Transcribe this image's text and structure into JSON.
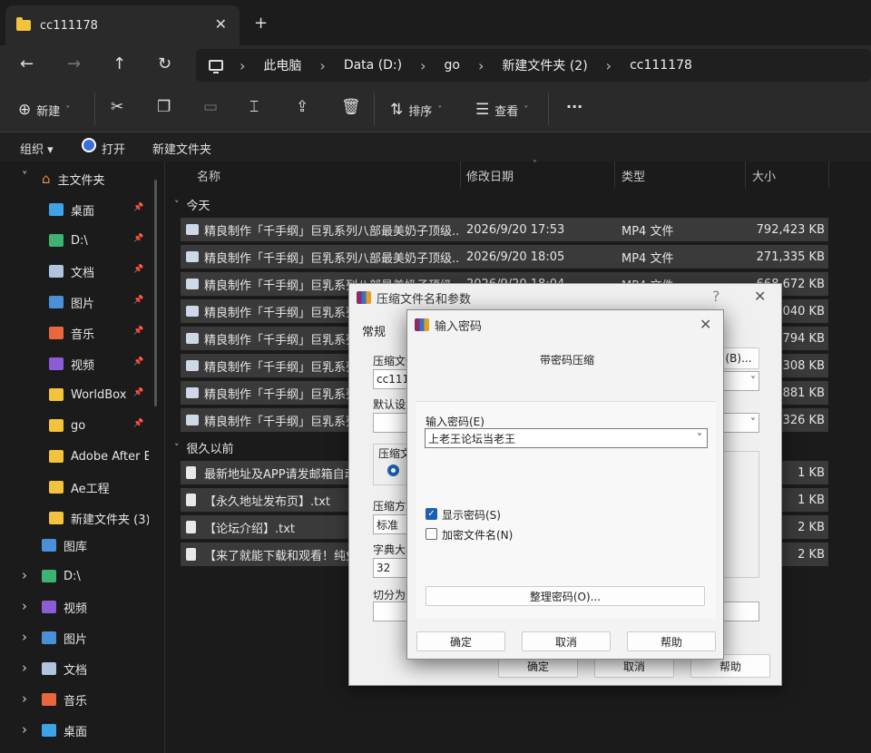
{
  "window": {
    "tab_title": "cc111178",
    "tab_close": "✕",
    "tab_add": "+"
  },
  "nav": {
    "back": "←",
    "forward": "→",
    "up": "↑",
    "refresh": "↻",
    "breadcrumbs": [
      "此电脑",
      "Data (D:)",
      "go",
      "新建文件夹 (2)",
      "cc111178"
    ],
    "sep": "›"
  },
  "toolbar": {
    "new_label": "新建",
    "sort_label": "排序",
    "view_label": "查看",
    "more": "···"
  },
  "cmdbar": {
    "organize": "组织 ▾",
    "open": "打开",
    "new_folder": "新建文件夹"
  },
  "sidebar": {
    "home": "主文件夹",
    "quick": [
      {
        "label": "桌面",
        "color": "#3fa3e8"
      },
      {
        "label": "D:\\",
        "color": "#3cb371"
      },
      {
        "label": "文档",
        "color": "#b0c4de"
      },
      {
        "label": "图片",
        "color": "#4a90d9"
      },
      {
        "label": "音乐",
        "color": "#e8673c"
      },
      {
        "label": "视频",
        "color": "#8a5cd6"
      },
      {
        "label": "WorldBox",
        "color": "#f3c33c"
      },
      {
        "label": "go",
        "color": "#f3c33c"
      },
      {
        "label": "Adobe After Effects",
        "color": "#f3c33c"
      },
      {
        "label": "Ae工程",
        "color": "#f3c33c"
      },
      {
        "label": "新建文件夹 (3)",
        "color": "#f3c33c"
      }
    ],
    "gallery": "图库",
    "bottom": [
      {
        "label": "D:\\",
        "color": "#3cb371"
      },
      {
        "label": "视频",
        "color": "#8a5cd6"
      },
      {
        "label": "图片",
        "color": "#4a90d9"
      },
      {
        "label": "文档",
        "color": "#b0c4de"
      },
      {
        "label": "音乐",
        "color": "#e8673c"
      },
      {
        "label": "桌面",
        "color": "#3fa3e8"
      }
    ]
  },
  "columns": {
    "name": "名称",
    "date": "修改日期",
    "type": "类型",
    "size": "大小"
  },
  "groups": {
    "today": "今天",
    "long_ago": "很久以前"
  },
  "files_today": [
    {
      "name": "精良制作「千手纲」巨乳系列八部最美奶子顶级...",
      "date": "2026/9/20 17:53",
      "type": "MP4 文件",
      "size": "792,423 KB"
    },
    {
      "name": "精良制作「千手纲」巨乳系列八部最美奶子顶级...",
      "date": "2026/9/20 18:05",
      "type": "MP4 文件",
      "size": "271,335 KB"
    },
    {
      "name": "精良制作「千手纲」巨乳系列八部最美奶子顶级...",
      "date": "2026/9/20 18:04",
      "type": "MP4 文件",
      "size": "668,672 KB"
    },
    {
      "name": "精良制作「千手纲」巨乳系列",
      "date": "",
      "type": "",
      "size": "1,040 KB"
    },
    {
      "name": "精良制作「千手纲」巨乳系列",
      "date": "",
      "type": "",
      "size": "1,794 KB"
    },
    {
      "name": "精良制作「千手纲」巨乳系列",
      "date": "",
      "type": "",
      "size": "1,308 KB"
    },
    {
      "name": "精良制作「千手纲」巨乳系列",
      "date": "",
      "type": "",
      "size": "1,881 KB"
    },
    {
      "name": "精良制作「千手纲」巨乳系列",
      "date": "",
      "type": "",
      "size": "1,326 KB"
    }
  ],
  "files_old": [
    {
      "name": "最新地址及APP请发邮箱自动",
      "size": "1 KB"
    },
    {
      "name": "【永久地址发布页】.txt",
      "size": "1 KB"
    },
    {
      "name": "【论坛介绍】.txt",
      "size": "2 KB"
    },
    {
      "name": "【来了就能下载和观看！纯免",
      "size": "2 KB"
    }
  ],
  "archive_dialog": {
    "title": "压缩文件名和参数",
    "help": "?",
    "close": "✕",
    "tab_general": "常规",
    "archive_name_label": "压缩文件",
    "archive_name_value": "cc1111",
    "browse": "(B)...",
    "default_profile_label": "默认设置",
    "format_label": "压缩文",
    "method_label": "压缩方式",
    "method_value": "标准",
    "dict_label": "字典大小",
    "dict_value": "32",
    "split_label": "切分为分卷",
    "ok": "确定",
    "cancel": "取消",
    "help_btn": "帮助"
  },
  "password_dialog": {
    "title": "输入密码",
    "close": "✕",
    "heading": "带密码压缩",
    "enter_label": "输入密码(E)",
    "password_value": "上老王论坛当老王",
    "show_password": "显示密码(S)",
    "encrypt_names": "加密文件名(N)",
    "organize": "整理密码(O)...",
    "ok": "确定",
    "cancel": "取消",
    "help": "帮助"
  }
}
